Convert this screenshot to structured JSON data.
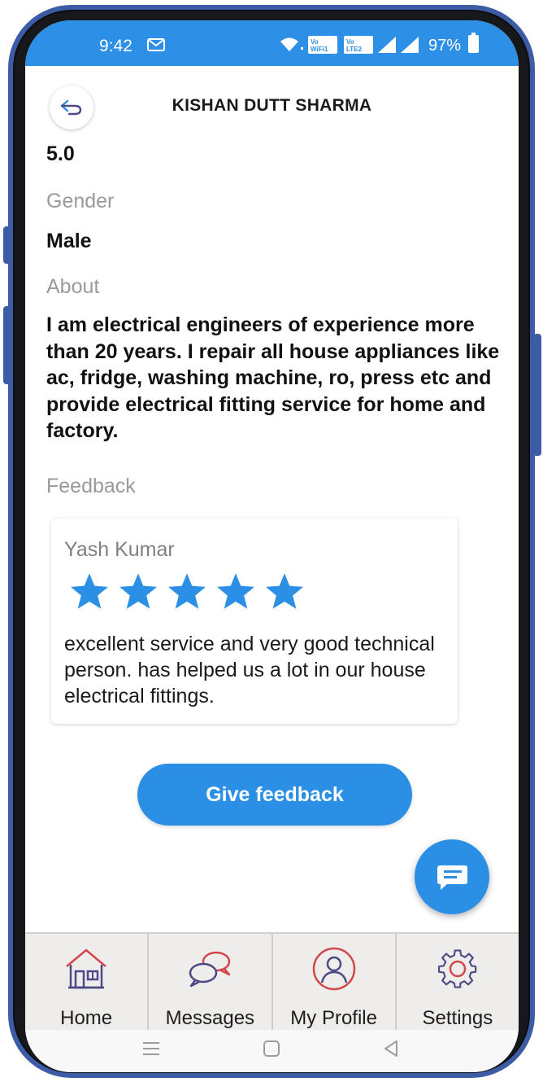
{
  "status_bar": {
    "time": "9:42",
    "battery": "97%",
    "mail_icon": "mail-notification-icon",
    "signal_icons": [
      "wifi-icon",
      "volte-wifi-icon",
      "volte-lte2-icon",
      "signal-icon",
      "signal-icon"
    ],
    "color": "#2d8fe6"
  },
  "header": {
    "title": "KISHAN DUTT SHARMA",
    "back_icon": "back-arrow-icon"
  },
  "profile": {
    "rating": "5.0",
    "gender_label": "Gender",
    "gender_value": "Male",
    "about_label": "About",
    "about_value": "I am electrical engineers of experience more than 20 years. I repair all house appliances like ac, fridge, washing machine, ro, press etc and provide electrical fitting service for home and factory.",
    "feedback_label": "Feedback"
  },
  "feedback": [
    {
      "name": "Yash Kumar",
      "stars": 5,
      "max_stars": 5,
      "text": "excellent service and very good technical person. has helped us a lot in our house electrical fittings."
    }
  ],
  "actions": {
    "give_feedback": "Give feedback",
    "fab_icon": "chat-icon"
  },
  "bottom_nav": [
    {
      "label": "Home",
      "icon": "home-icon"
    },
    {
      "label": "Messages",
      "icon": "messages-icon"
    },
    {
      "label": "My Profile",
      "icon": "profile-icon"
    },
    {
      "label": "Settings",
      "icon": "settings-icon"
    }
  ],
  "system_nav": [
    "menu-icon",
    "home-square-icon",
    "back-triangle-icon"
  ],
  "colors": {
    "accent": "#2b90e5",
    "star": "#2b90e5",
    "label_gray": "#9a9a9a",
    "nav_bg": "#efedeb",
    "icon_purple": "#4b4a86",
    "icon_red": "#d2474a"
  }
}
